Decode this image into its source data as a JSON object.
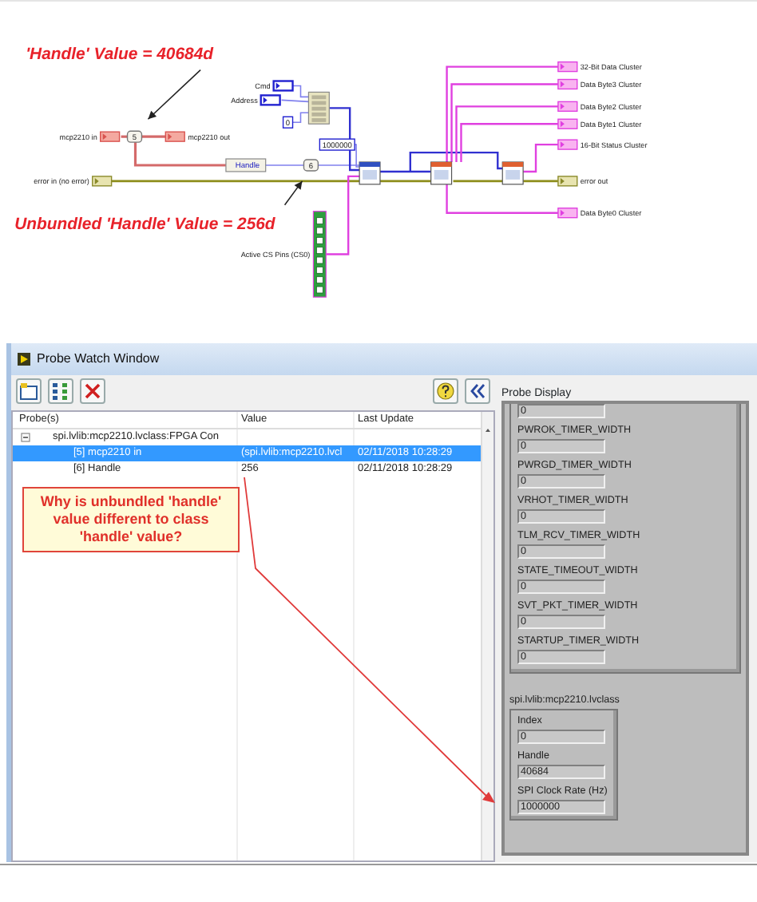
{
  "diagram": {
    "annotations": [
      {
        "text": "'Handle' Value = 40684d"
      },
      {
        "text": "Unbundled 'Handle' Value = 256d"
      }
    ],
    "terminals": [
      {
        "label": "mcp2210 in",
        "kind": "class"
      },
      {
        "label": "mcp2210 out",
        "kind": "class"
      },
      {
        "label": "error in (no error)",
        "kind": "error"
      },
      {
        "label": "error out",
        "kind": "error"
      },
      {
        "label": "Cmd",
        "kind": "numeric"
      },
      {
        "label": "Address",
        "kind": "numeric"
      },
      {
        "label": "Active CS Pins (CS0)",
        "kind": "boolean_array"
      },
      {
        "label": "32-Bit Data Cluster",
        "kind": "cluster"
      },
      {
        "label": "Data Byte3 Cluster",
        "kind": "cluster"
      },
      {
        "label": "Data Byte2 Cluster",
        "kind": "cluster"
      },
      {
        "label": "Data Byte1 Cluster",
        "kind": "cluster"
      },
      {
        "label": "16-Bit Status Cluster",
        "kind": "cluster"
      },
      {
        "label": "Data Byte0 Cluster",
        "kind": "cluster"
      }
    ],
    "unbundle": {
      "label": "Handle"
    },
    "constants": [
      "5",
      "6",
      "1000000",
      "0"
    ]
  },
  "probe_window": {
    "title": "Probe Watch Window",
    "columns": [
      "Probe(s)",
      "Value",
      "Last Update"
    ],
    "probes": [
      {
        "label": "spi.lvlib:mcp2210.lvclass:FPGA Con",
        "expanded": true,
        "children": [
          {
            "probe": "[5] mcp2210 in",
            "value": "(spi.lvlib:mcp2210.lvcl",
            "last_update": "02/11/2018 10:28:29",
            "selected": true
          },
          {
            "probe": "[6] Handle",
            "value": "256",
            "last_update": "02/11/2018 10:28:29",
            "selected": false
          }
        ]
      }
    ],
    "display": {
      "title": "Probe Display",
      "timer_fields": [
        {
          "value": "0"
        },
        {
          "label": "PWROK_TIMER_WIDTH",
          "value": "0"
        },
        {
          "label": "PWRGD_TIMER_WIDTH",
          "value": "0"
        },
        {
          "label": "VRHOT_TIMER_WIDTH",
          "value": "0"
        },
        {
          "label": "TLM_RCV_TIMER_WIDTH",
          "value": "0"
        },
        {
          "label": "STATE_TIMEOUT_WIDTH",
          "value": "0"
        },
        {
          "label": "SVT_PKT_TIMER_WIDTH",
          "value": "0"
        },
        {
          "label": "STARTUP_TIMER_WIDTH",
          "value": "0"
        }
      ],
      "class_cluster": {
        "label": "spi.lvlib:mcp2210.lvclass",
        "fields": [
          {
            "label": "Index",
            "value": "0"
          },
          {
            "label": "Handle",
            "value": "40684"
          },
          {
            "label": "SPI Clock Rate (Hz)",
            "value": "1000000"
          }
        ]
      }
    }
  },
  "callout": {
    "text": "Why is unbundled 'handle' value different to class 'handle' value?"
  }
}
